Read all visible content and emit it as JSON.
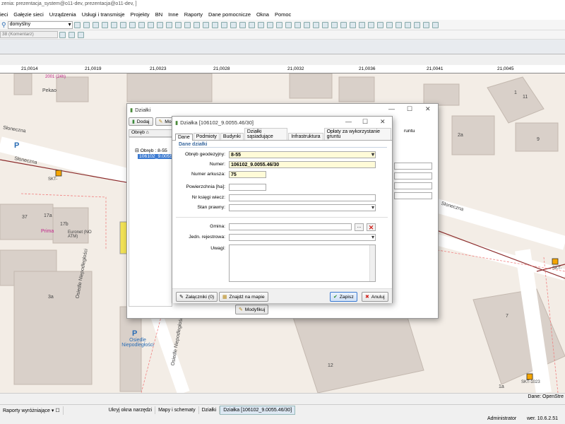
{
  "window": {
    "title": "zenia: prezentacja_system@o11-dev, prezentacja@o11-dev, ]"
  },
  "menu": [
    "ieci",
    "Gałęzie sieci",
    "Urządzenia",
    "Usługi i transmisje",
    "Projekty",
    "BN",
    "Inne",
    "Raporty",
    "Dane pomocnicze",
    "Okna",
    "Pomoc"
  ],
  "toolbar": {
    "profile_value": "domyślny",
    "layer_value": "38 (Komentarz)"
  },
  "ruler": [
    "21,0014",
    "21,0019",
    "21,0023",
    "21,0028",
    "21,0032",
    "21,0036",
    "21,0041",
    "21,0045"
  ],
  "map_labels": {
    "street1": "Słoneczna",
    "street2": "Słoneczna",
    "street3": "Słoneczna",
    "street4": "Osiedle Niepodległości",
    "street5": "Osiedle Niepodległości",
    "poi_pekao": "Pekao",
    "poi_euronet": "Euronet (NO ATM)",
    "poi_prima": "Prima",
    "poi_osiedle": "Osiedle Niepodległości",
    "poi_2001": "2001 (24h)",
    "skt1": "SKT-",
    "skt2": "SKT-",
    "skt3": "SKT-1023",
    "num_37": "37",
    "num_17a": "17a",
    "num_17b": "17b",
    "num_3a": "3a",
    "num_2a": "2a",
    "num_1": "1",
    "num_9": "9",
    "num_11": "11",
    "num_12": "12",
    "num_7": "7",
    "num_1a": "1a"
  },
  "back_dialog": {
    "title": "Działki",
    "add_label": "Dodaj",
    "modify_label": "Mody",
    "column_header": "Obręb",
    "tree_group": "Obręb : 8-55",
    "tree_item": "106102_9.0055.",
    "modify_bottom": "Modyfikuj",
    "right_tab_fragment": "runtu"
  },
  "dialog": {
    "title": "Działka [106102_9.0055.46/30]",
    "tabs": [
      "Dane",
      "Podmioty",
      "Budynki",
      "Działki sąsiadujące",
      "Infrastruktura",
      "Opłaty za wykorzystanie gruntu"
    ],
    "section": "Dane działki",
    "labels": {
      "obreb": "Obręb geodezyjny:",
      "numer": "Numer:",
      "arkusz": "Numer arkusza:",
      "pow": "Powierzchnia [ha]:",
      "ksiega": "Nr księgi wiecz:",
      "stan": "Stan prawny:",
      "gmina": "Gmina:",
      "jedn": "Jedn. rejestrowa:",
      "uwagi": "Uwagi:"
    },
    "values": {
      "obreb": "8-55",
      "numer": "106102_9.0055.46/30",
      "arkusz": "75"
    },
    "buttons": {
      "attach": "Załączniki (0)",
      "find": "Znajdź na mapie",
      "save": "Zapisz",
      "cancel": "Anuluj"
    }
  },
  "map_status": "Dane: OpenStre",
  "taskbar": [
    "Raporty wyróżniające",
    "Ukryj okna narzędzi",
    "Mapy i schematy",
    "Działki",
    "Działka [106102_9.0055.46/30]"
  ],
  "statusbar": {
    "user": "Administrator",
    "version": "wer. 10.6.2.51"
  },
  "colors": {
    "map_bg": "#f3ede6",
    "building": "#d9d0c9",
    "road": "#ffffff",
    "accent": "#3b7ad1",
    "yellow_field": "#fffbd8"
  }
}
